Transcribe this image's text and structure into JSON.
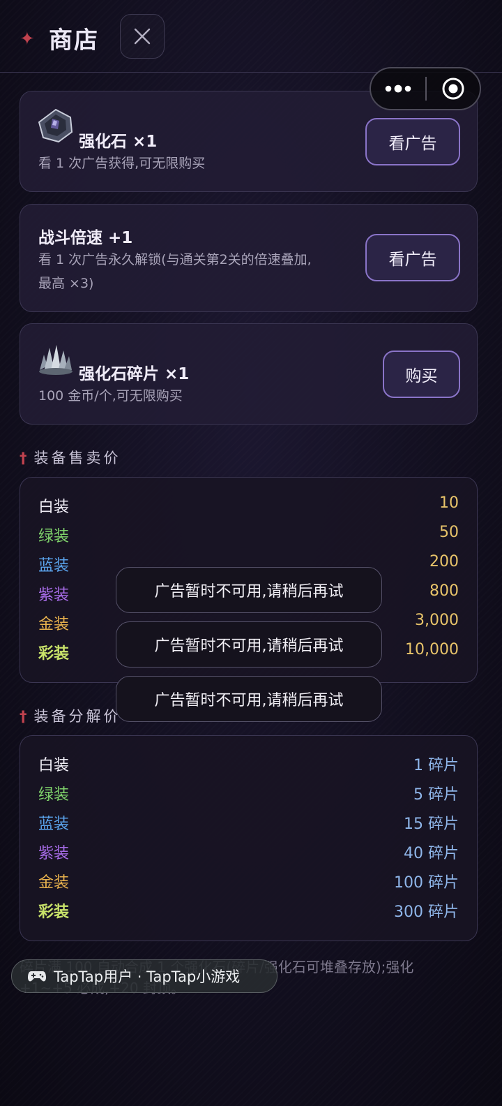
{
  "header": {
    "title": "商店"
  },
  "shop": {
    "items": [
      {
        "name": "强化石 ×1",
        "desc": "看 1 次广告获得,可无限购买",
        "button": "看广告"
      },
      {
        "name": "战斗倍速 +1",
        "desc_line1": "看 1 次广告永久解锁(与通关第2关的倍速叠加,",
        "desc_line2": "最高 ×3)",
        "button": "看广告"
      },
      {
        "name": "强化石碎片 ×1",
        "desc": "100 金币/个,可无限购买",
        "button": "购买"
      }
    ]
  },
  "sell_section": {
    "title": "装备售卖价",
    "rows": [
      {
        "tier": "白装",
        "value": "10",
        "color": "#f0eef6"
      },
      {
        "tier": "绿装",
        "value": "50",
        "color": "#7fd36b"
      },
      {
        "tier": "蓝装",
        "value": "200",
        "color": "#5aa2ea"
      },
      {
        "tier": "紫装",
        "value": "800",
        "color": "#a66be6"
      },
      {
        "tier": "金装",
        "value": "3,000",
        "color": "#e7b14d"
      },
      {
        "tier": "彩装",
        "value": "10,000",
        "color": "#c9e36a"
      }
    ],
    "value_color": "#e8c46a"
  },
  "decompose_section": {
    "title": "装备分解价",
    "rows": [
      {
        "tier": "白装",
        "value": "1 碎片",
        "color": "#f0eef6"
      },
      {
        "tier": "绿装",
        "value": "5 碎片",
        "color": "#7fd36b"
      },
      {
        "tier": "蓝装",
        "value": "15 碎片",
        "color": "#5aa2ea"
      },
      {
        "tier": "紫装",
        "value": "40 碎片",
        "color": "#a66be6"
      },
      {
        "tier": "金装",
        "value": "100 碎片",
        "color": "#e7b14d"
      },
      {
        "tier": "彩装",
        "value": "300 碎片",
        "color": "#c9e36a"
      }
    ],
    "value_color": "#8fb6ea"
  },
  "toasts": [
    "广告暂时不可用,请稍后再试",
    "广告暂时不可用,请稍后再试",
    "广告暂时不可用,请稍后再试"
  ],
  "footer": {
    "line1": "碎片满 100 自动合成 1 个强化石(碎片/强化石可堆叠存放);强化",
    "line2": "+1~+5 必成,+20 封顶。"
  },
  "taptap": {
    "label": "TapTap用户 · TapTap小游戏",
    "icon": "gamepad-icon"
  },
  "colors": {
    "accent_red": "#c0424e",
    "button_border": "#8a74c8"
  }
}
